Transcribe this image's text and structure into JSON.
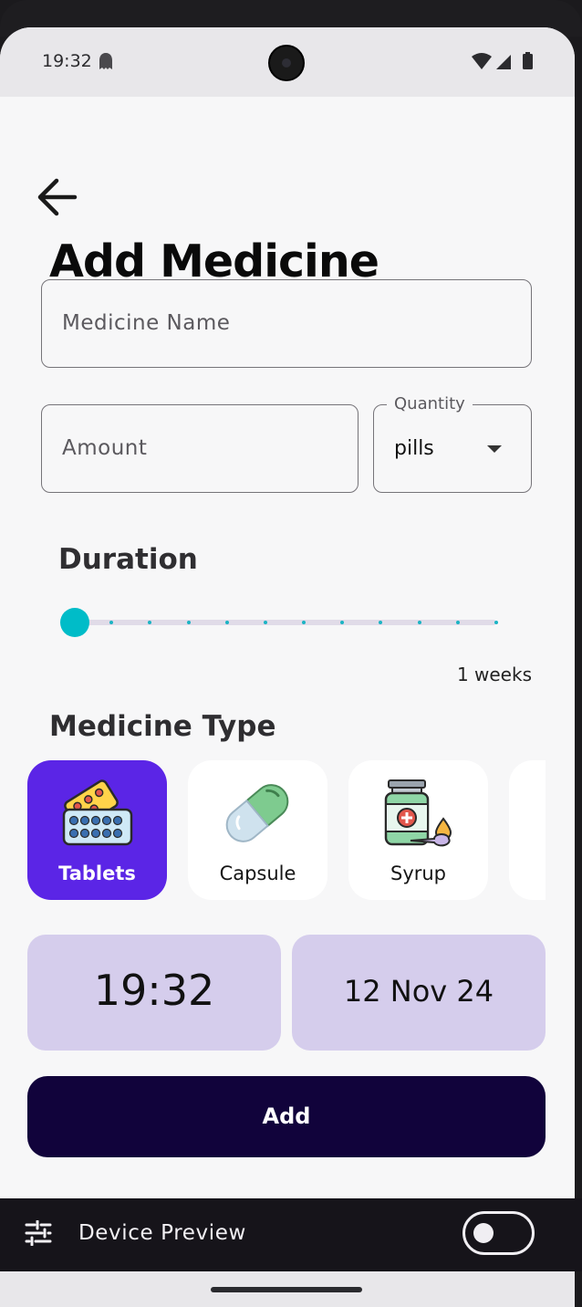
{
  "status_bar": {
    "time": "19:32"
  },
  "page": {
    "title": "Add Medicine",
    "medicine_name_placeholder": "Medicine Name",
    "amount_placeholder": "Amount",
    "quantity": {
      "label": "Quantity",
      "value": "pills"
    }
  },
  "duration": {
    "title": "Duration",
    "value_label": "1 weeks",
    "slider_level": 0,
    "slider_divisions": 11
  },
  "medicine_type": {
    "title": "Medicine Type",
    "items": [
      {
        "label": "Tablets",
        "icon": "tablets-icon",
        "selected": true
      },
      {
        "label": "Capsule",
        "icon": "capsule-icon",
        "selected": false
      },
      {
        "label": "Syrup",
        "icon": "syrup-icon",
        "selected": false
      }
    ]
  },
  "time": "19:32",
  "date": "12 Nov 24",
  "add_button_label": "Add",
  "device_preview": {
    "label": "Device Preview",
    "toggle_on": false
  },
  "colors": {
    "selected_type": "#5b25e6",
    "time_box": "#d5cdec",
    "add_button": "#11033b",
    "slider": "#00bcc8"
  }
}
